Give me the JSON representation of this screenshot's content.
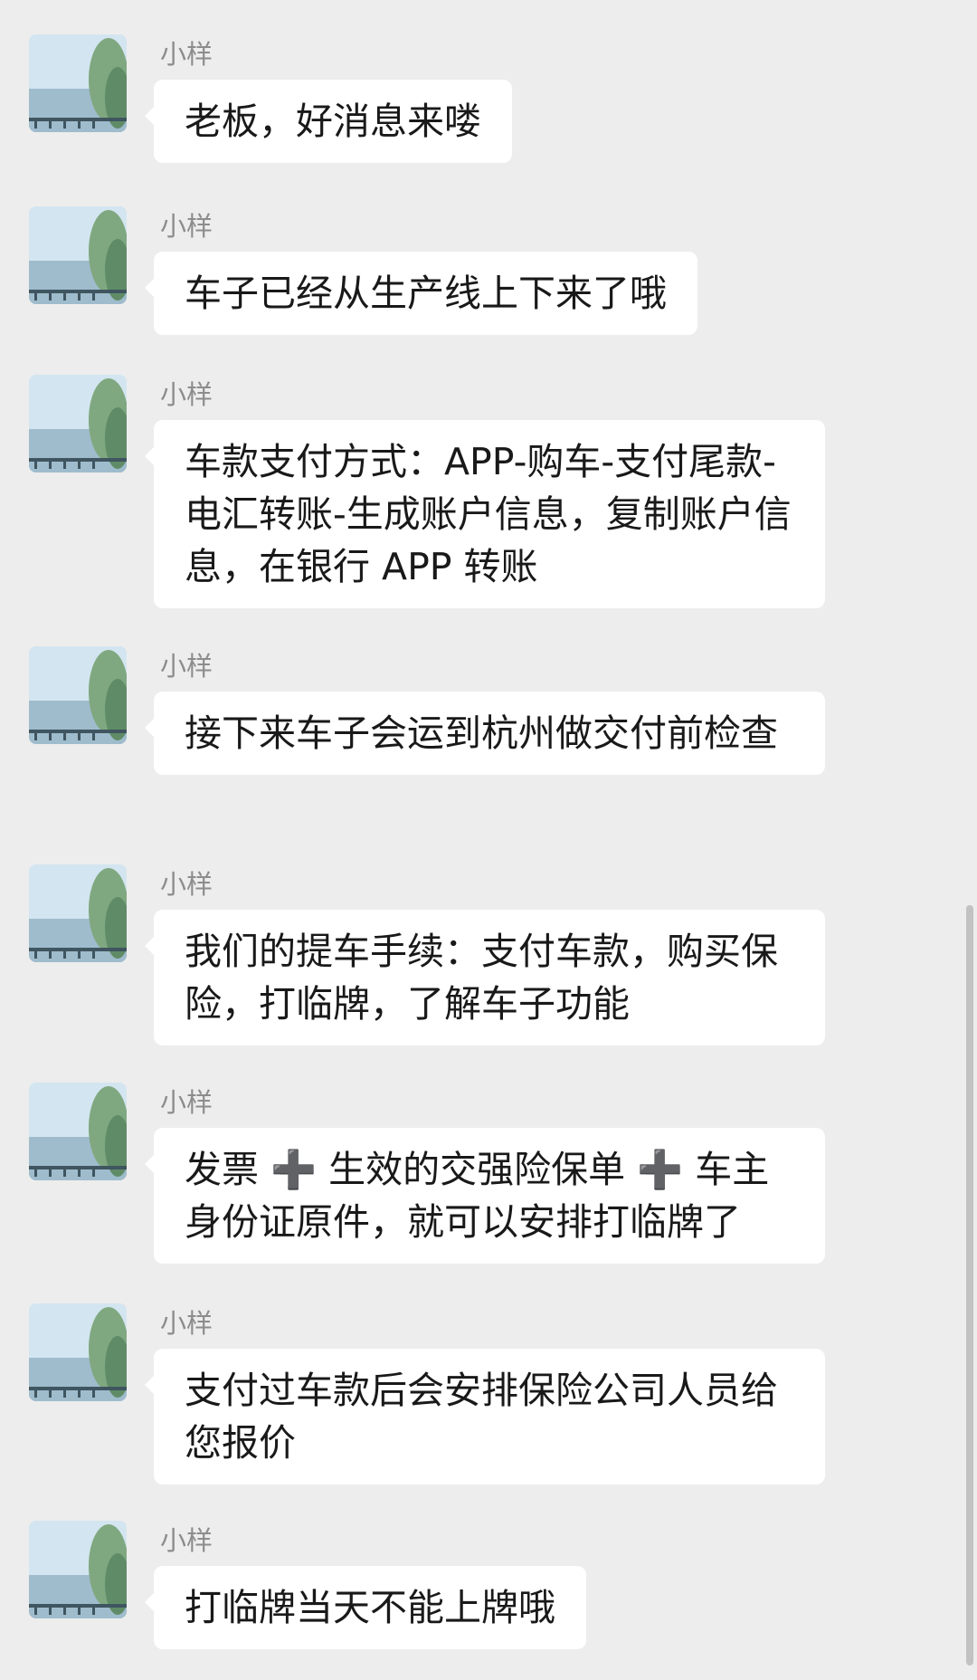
{
  "chat": {
    "messages": [
      {
        "sender": "小样",
        "text": "老板，好消息来喽",
        "avatar": "willow-lake-avatar"
      },
      {
        "sender": "小样",
        "text": "车子已经从生产线上下来了哦",
        "avatar": "willow-lake-avatar"
      },
      {
        "sender": "小样",
        "text": "车款支付方式：APP-购车-支付尾款-电汇转账-生成账户信息，复制账户信息，在银行 APP 转账",
        "avatar": "willow-lake-avatar"
      },
      {
        "sender": "小样",
        "text": "接下来车子会运到杭州做交付前检查",
        "avatar": "willow-lake-avatar"
      },
      {
        "sender": "小样",
        "text": "我们的提车手续：支付车款，购买保险，打临牌，了解车子功能",
        "avatar": "willow-lake-avatar"
      },
      {
        "sender": "小样",
        "text": "发票 ➕ 生效的交强险保单 ➕ 车主身份证原件，就可以安排打临牌了",
        "avatar": "willow-lake-avatar"
      },
      {
        "sender": "小样",
        "text": "支付过车款后会安排保险公司人员给您报价",
        "avatar": "willow-lake-avatar"
      },
      {
        "sender": "小样",
        "text": "打临牌当天不能上牌哦",
        "avatar": "willow-lake-avatar"
      }
    ]
  },
  "colors": {
    "background": "#ededed",
    "bubble": "#ffffff",
    "text": "#191919",
    "sender": "#8c8c8c"
  }
}
